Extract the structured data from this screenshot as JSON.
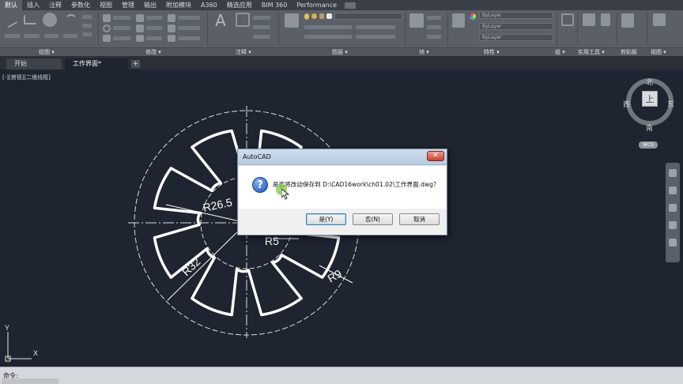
{
  "ribbon_tabs": [
    "默认",
    "插入",
    "注释",
    "参数化",
    "视图",
    "管理",
    "输出",
    "附加模块",
    "A360",
    "精选应用",
    "BIM 360",
    "Performance"
  ],
  "active_tab_index": 0,
  "panel_titles": {
    "draw": "绘图 ▾",
    "modify": "修改 ▾",
    "annotate": "注释 ▾",
    "layer": "图层 ▾",
    "block": "块 ▾",
    "properties": "特性 ▾",
    "group": "组 ▾",
    "utilities": "实用工具 ▾",
    "clipboard": "剪贴板",
    "view": "视图 ▾"
  },
  "properties_dropdowns": [
    "ByLayer",
    "ByLayer",
    "ByLayer"
  ],
  "document_tabs": [
    "开始",
    "工作界面*"
  ],
  "active_document_index": 1,
  "add_tab_label": "+",
  "viewport_label": "[-][俯视][二维线框]",
  "viewcube": {
    "north": "北",
    "south": "南",
    "east": "东",
    "west": "西",
    "face": "上",
    "wcs": "WCS"
  },
  "ucs": {
    "y": "Y",
    "x": "X"
  },
  "drawing_dimensions": {
    "r1": "R26.5",
    "r2": "R5",
    "r3": "R32",
    "r4": "R9"
  },
  "dialog": {
    "title": "AutoCAD",
    "close": "✕",
    "icon": "?",
    "message": "是否将改动保存到 D:\\CAD16work\\ch01.02\\工作界面.dwg？",
    "buttons": {
      "yes": "是(Y)",
      "no": "否(N)",
      "cancel": "取消"
    }
  },
  "command_prompt": "命令:",
  "colors": {
    "canvas": "#1e2430",
    "ribbon": "#5b6067",
    "dialog_accent": "#3c7fb1",
    "close_red": "#c8412a"
  }
}
